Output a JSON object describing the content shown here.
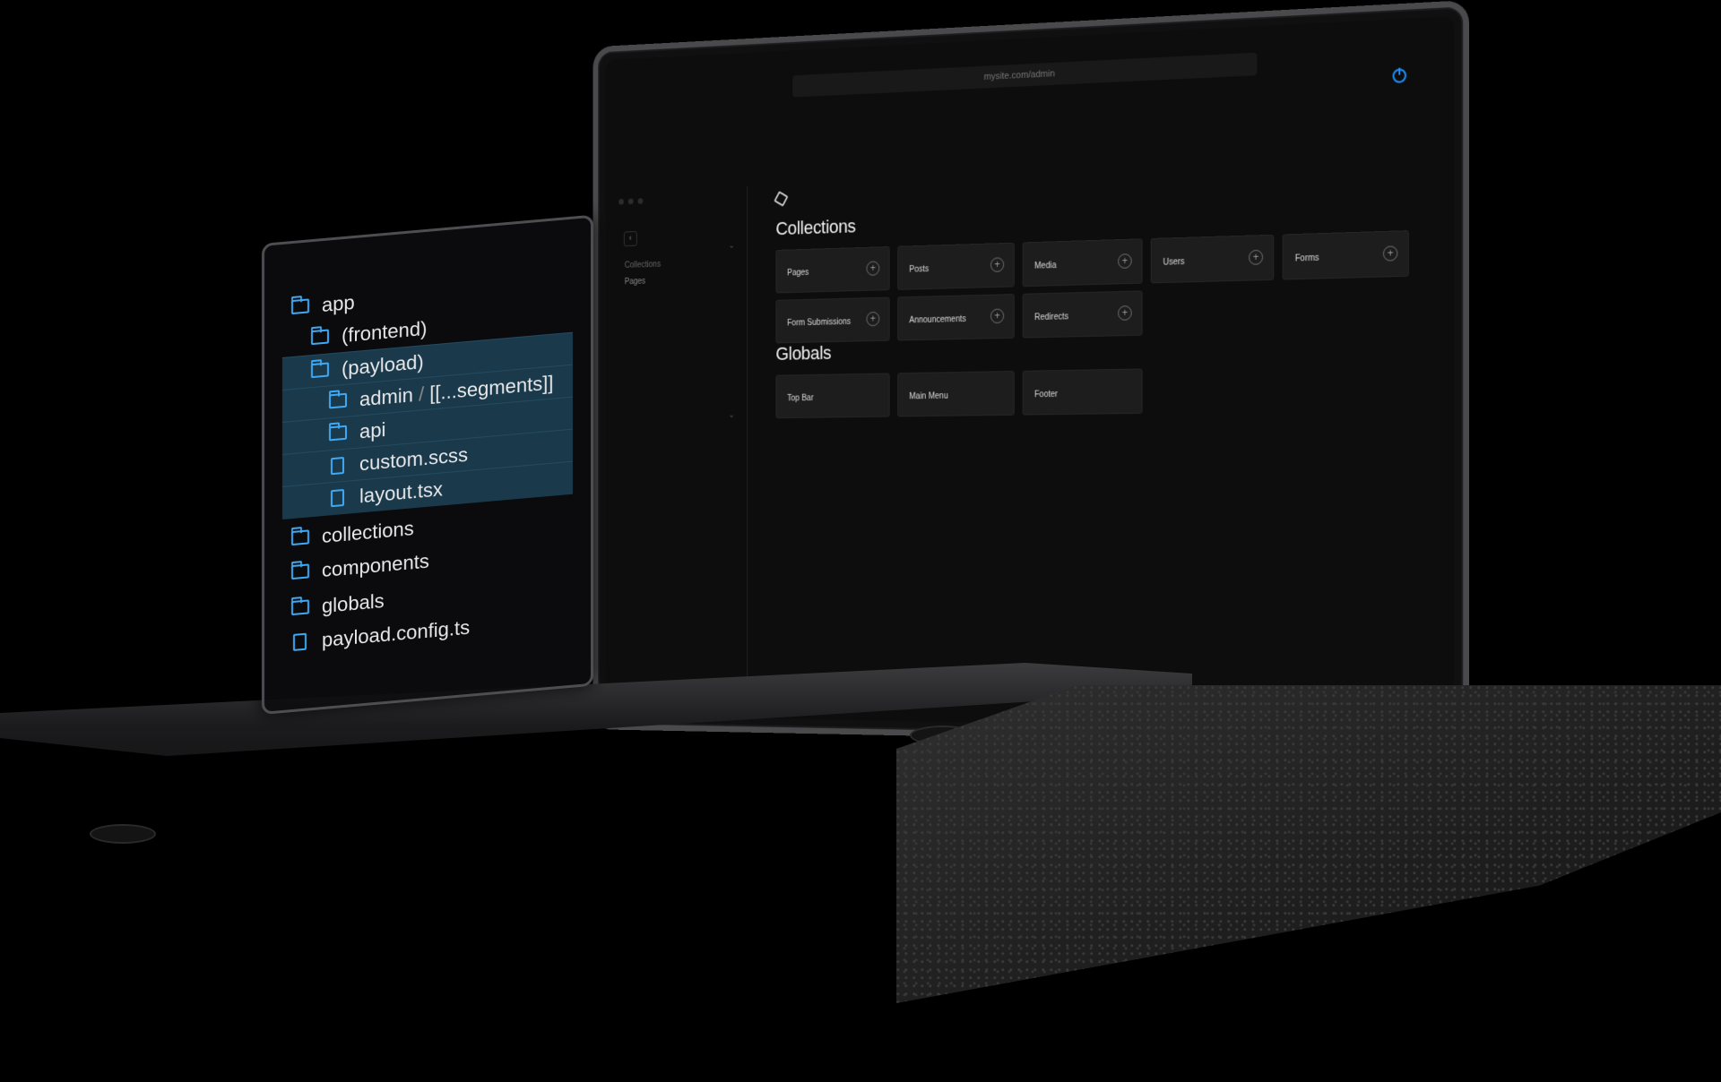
{
  "browser": {
    "url": "mysite.com/admin"
  },
  "sidebar": {
    "back_label": "‹",
    "items": [
      {
        "label": "Collections"
      },
      {
        "label": "Pages"
      }
    ]
  },
  "main": {
    "collections_title": "Collections",
    "collections": [
      {
        "label": "Pages"
      },
      {
        "label": "Posts"
      },
      {
        "label": "Media"
      },
      {
        "label": "Users"
      },
      {
        "label": "Forms"
      },
      {
        "label": "Form Submissions"
      },
      {
        "label": "Announcements"
      },
      {
        "label": "Redirects"
      }
    ],
    "globals_title": "Globals",
    "globals": [
      {
        "label": "Top Bar"
      },
      {
        "label": "Main Menu"
      },
      {
        "label": "Footer"
      }
    ],
    "plus_label": "+"
  },
  "file_tree": {
    "rows": [
      {
        "label": "app",
        "type": "folder-open"
      },
      {
        "label": "(frontend)",
        "type": "folder"
      },
      {
        "label": "(payload)",
        "type": "folder-open"
      },
      {
        "label": "admin",
        "sep": "/",
        "label2": "[[...segments]]",
        "type": "folder"
      },
      {
        "label": "api",
        "type": "folder"
      },
      {
        "label": "custom.scss",
        "type": "file"
      },
      {
        "label": "layout.tsx",
        "type": "file"
      },
      {
        "label": "collections",
        "type": "folder"
      },
      {
        "label": "components",
        "type": "folder"
      },
      {
        "label": "globals",
        "type": "folder"
      },
      {
        "label": "payload.config.ts",
        "type": "file"
      }
    ]
  },
  "colors": {
    "accent": "#3fa9f5",
    "selection": "#1a3a4c",
    "power_icon": "#1e90ff"
  }
}
